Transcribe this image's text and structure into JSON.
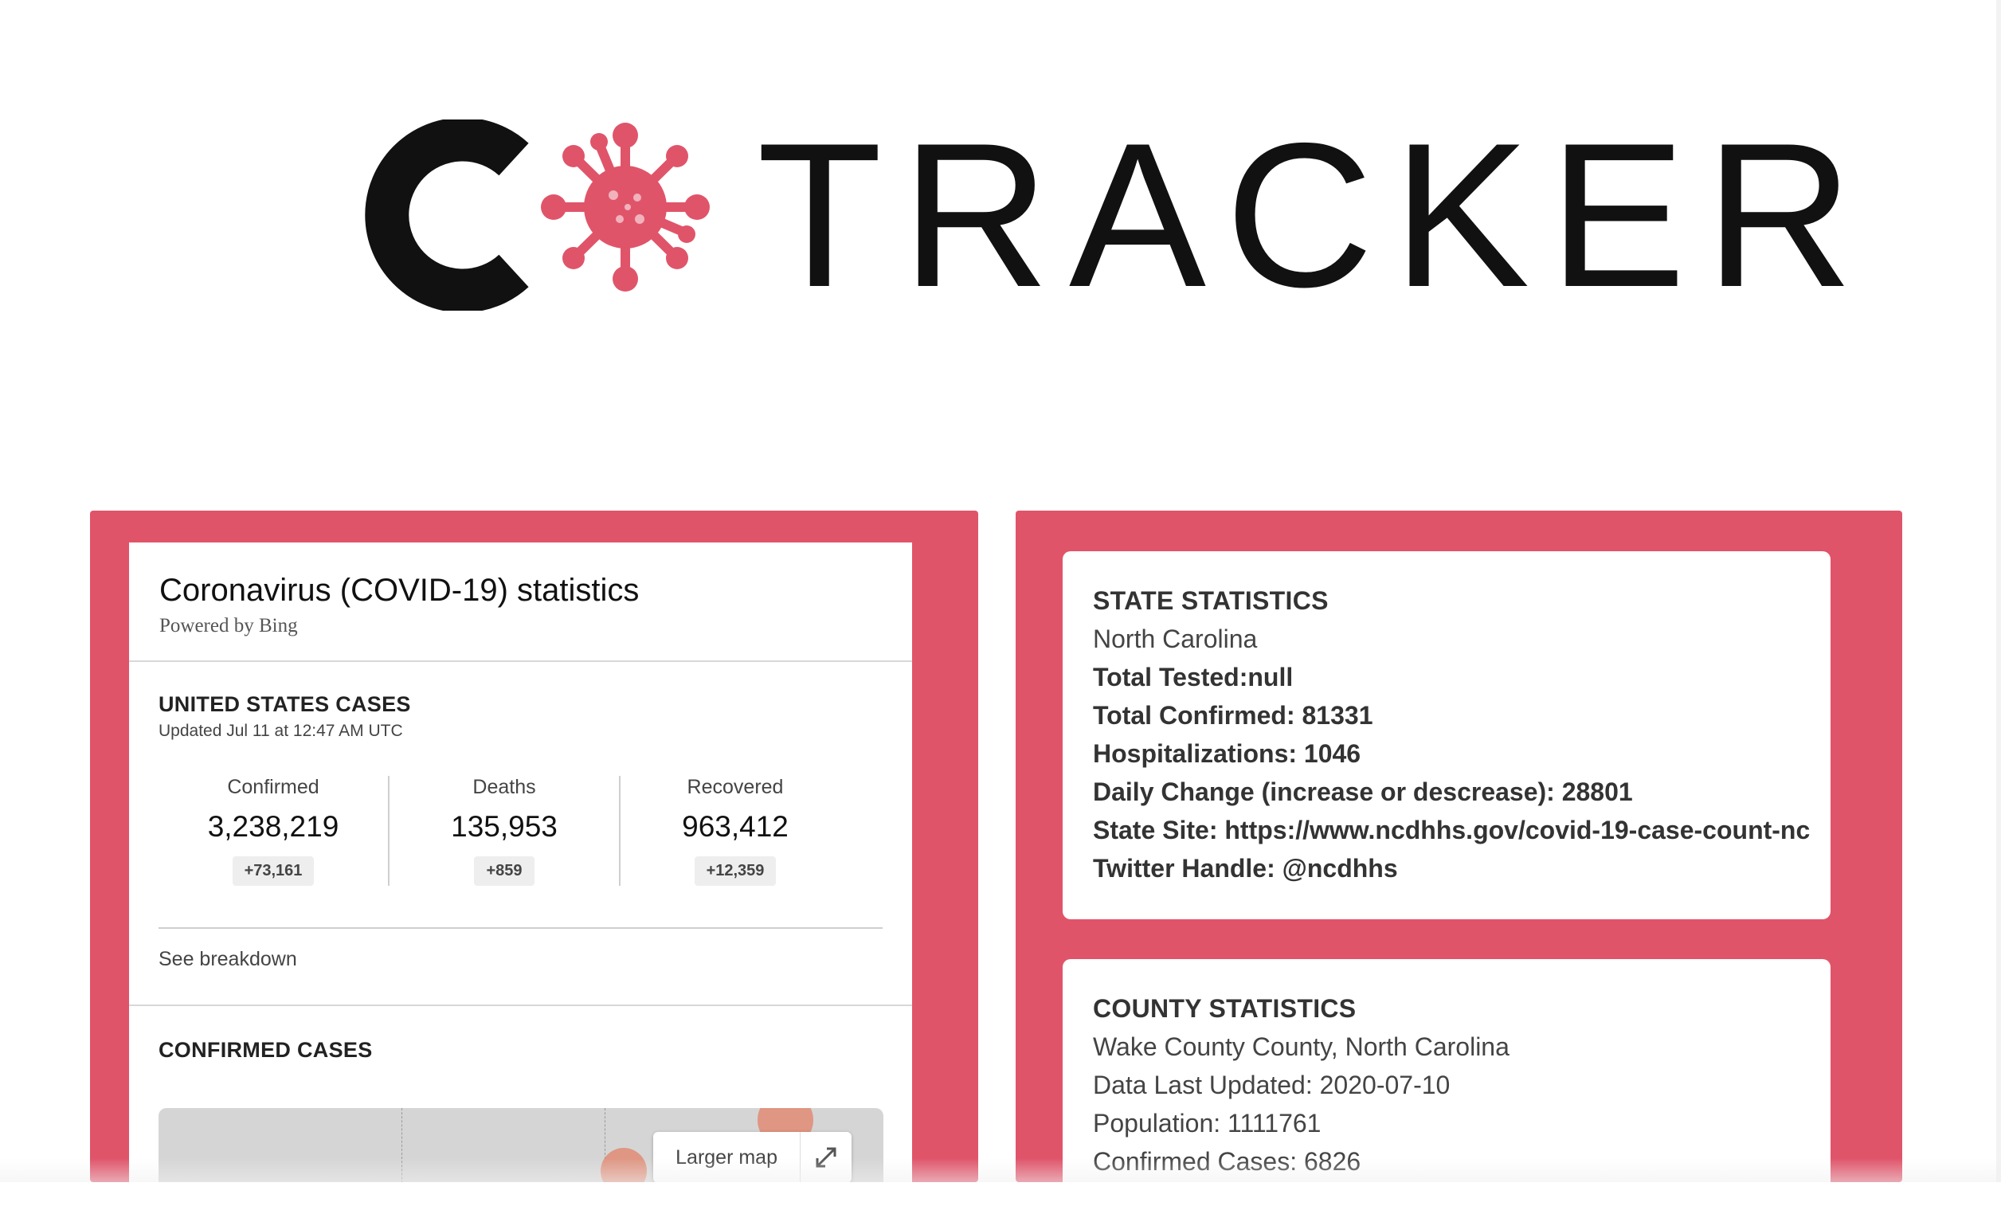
{
  "logo": {
    "letter_c": "C",
    "text": "TRACKER",
    "virus_color": "#e0546a"
  },
  "colors": {
    "accent": "#e0546a",
    "map_bubble": "#e0907c"
  },
  "bing_widget": {
    "title": "Coronavirus (COVID-19) statistics",
    "powered_by": "Powered by Bing",
    "us_heading": "UNITED STATES CASES",
    "updated": "Updated Jul 11 at 12:47 AM UTC",
    "stats": [
      {
        "label": "Confirmed",
        "value": "3,238,219",
        "delta": "+73,161"
      },
      {
        "label": "Deaths",
        "value": "135,953",
        "delta": "+859"
      },
      {
        "label": "Recovered",
        "value": "963,412",
        "delta": "+12,359"
      }
    ],
    "see_breakdown": "See breakdown",
    "confirmed_heading": "CONFIRMED CASES",
    "larger_map": "Larger map",
    "expand_icon": "expand-arrows-icon"
  },
  "state_stats": {
    "heading": "STATE STATISTICS",
    "state": "North Carolina",
    "total_tested": "Total Tested:null",
    "total_confirmed": "Total Confirmed: 81331",
    "hospitalizations": "Hospitalizations: 1046",
    "daily_change": "Daily Change (increase or descrease): 28801",
    "state_site": "State Site: https://www.ncdhhs.gov/covid-19-case-count-nc",
    "twitter": "Twitter Handle: @ncdhhs"
  },
  "county_stats": {
    "heading": "COUNTY STATISTICS",
    "county": "Wake County County, North Carolina",
    "last_updated": "Data Last Updated: 2020-07-10",
    "population": "Population: 1111761",
    "confirmed": "Confirmed Cases: 6826"
  }
}
